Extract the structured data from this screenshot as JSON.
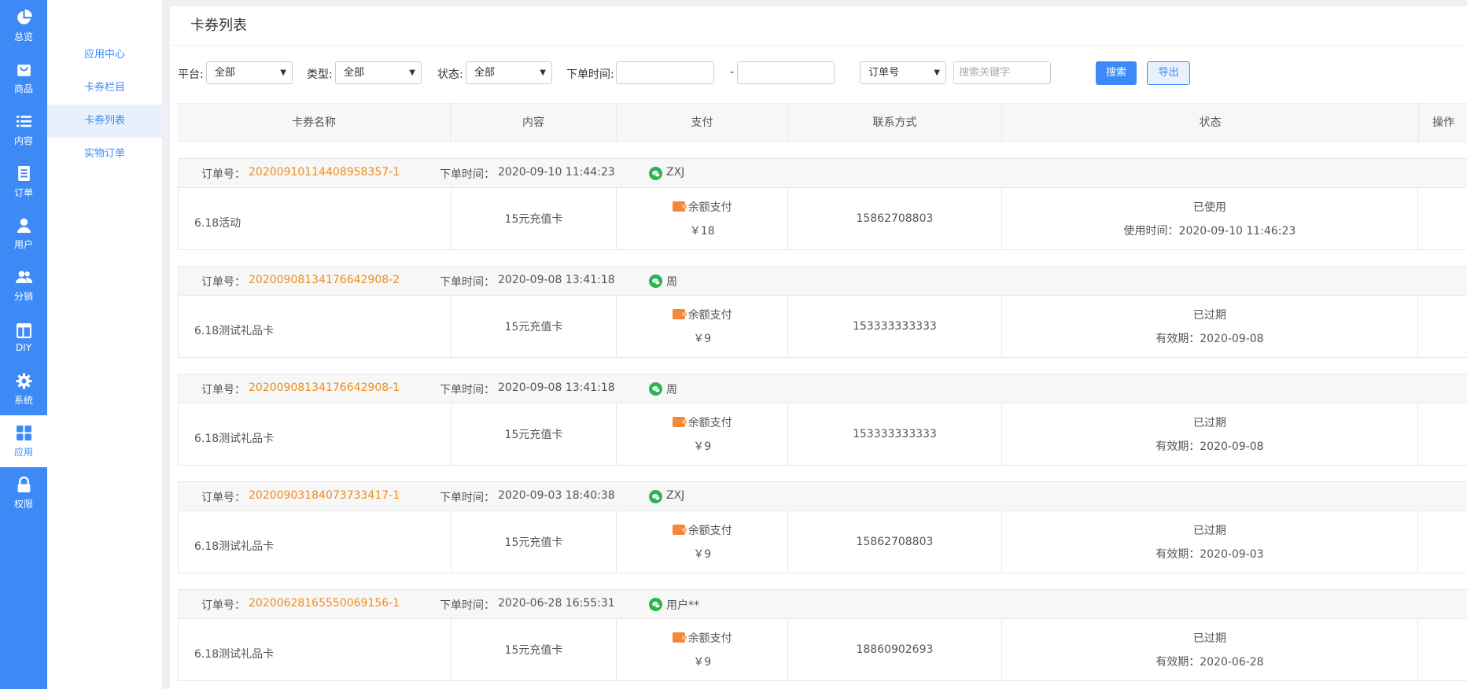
{
  "nav": [
    {
      "label": "总览",
      "icon": "pie-chart-icon"
    },
    {
      "label": "商品",
      "icon": "shopping-bag-icon"
    },
    {
      "label": "内容",
      "icon": "list-icon"
    },
    {
      "label": "订单",
      "icon": "document-icon"
    },
    {
      "label": "用户",
      "icon": "user-icon"
    },
    {
      "label": "分销",
      "icon": "users-icon"
    },
    {
      "label": "DIY",
      "icon": "layout-icon"
    },
    {
      "label": "系统",
      "icon": "gear-icon"
    },
    {
      "label": "应用",
      "icon": "grid-icon"
    },
    {
      "label": "权限",
      "icon": "lock-icon"
    }
  ],
  "submenu": [
    "应用中心",
    "卡券栏目",
    "卡券列表",
    "实物订单"
  ],
  "page_title": "卡券列表",
  "filters": {
    "platform_label": "平台:",
    "platform_value": "全部",
    "type_label": "类型:",
    "type_value": "全部",
    "status_label": "状态:",
    "status_value": "全部",
    "time_label": "下单时间:",
    "range_sep": "-",
    "field_value": "订单号",
    "keyword_placeholder": "搜索关键字",
    "search_label": "搜索",
    "export_label": "导出"
  },
  "columns": [
    "卡券名称",
    "内容",
    "支付",
    "联系方式",
    "状态",
    "操作"
  ],
  "order_no_label": "订单号：",
  "order_time_label": "下单时间：",
  "orders": [
    {
      "no": "20200910114408958357-1",
      "time": "2020-09-10 11:44:23",
      "buyer": "ZXJ",
      "name": "6.18活动",
      "content": "15元充值卡",
      "pay_method": "余额支付",
      "amount": "￥18",
      "contact": "15862708803",
      "status": "已使用",
      "status_detail": "使用时间：2020-09-10 11:46:23"
    },
    {
      "no": "20200908134176642908-2",
      "time": "2020-09-08 13:41:18",
      "buyer": "周",
      "name": "6.18测试礼品卡",
      "content": "15元充值卡",
      "pay_method": "余额支付",
      "amount": "￥9",
      "contact": "153333333333",
      "status": "已过期",
      "status_detail": "有效期：2020-09-08"
    },
    {
      "no": "20200908134176642908-1",
      "time": "2020-09-08 13:41:18",
      "buyer": "周",
      "name": "6.18测试礼品卡",
      "content": "15元充值卡",
      "pay_method": "余额支付",
      "amount": "￥9",
      "contact": "153333333333",
      "status": "已过期",
      "status_detail": "有效期：2020-09-08"
    },
    {
      "no": "20200903184073733417-1",
      "time": "2020-09-03 18:40:38",
      "buyer": "ZXJ",
      "name": "6.18测试礼品卡",
      "content": "15元充值卡",
      "pay_method": "余额支付",
      "amount": "￥9",
      "contact": "15862708803",
      "status": "已过期",
      "status_detail": "有效期：2020-09-03"
    },
    {
      "no": "20200628165550069156-1",
      "time": "2020-06-28 16:55:31",
      "buyer": "用户**",
      "name": "6.18测试礼品卡",
      "content": "15元充值卡",
      "pay_method": "余额支付",
      "amount": "￥9",
      "contact": "18860902693",
      "status": "已过期",
      "status_detail": "有效期：2020-06-28"
    }
  ]
}
